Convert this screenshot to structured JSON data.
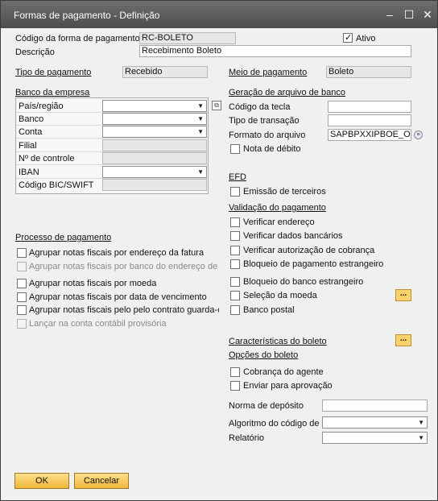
{
  "window": {
    "title": "Formas de pagamento - Definição",
    "minimize_glyph": "–",
    "maximize_glyph": "☐",
    "close_glyph": "✕"
  },
  "header": {
    "codigo_label": "Código da forma de pagamento",
    "codigo_value": "RC-BOLETO",
    "ativo_label": "Ativo",
    "ativo_checked": true,
    "descricao_label": "Descrição",
    "descricao_value": "Recebimento Boleto"
  },
  "tipo_pagamento": {
    "label": "Tipo de pagamento",
    "value": "Recebido"
  },
  "meio_pagamento": {
    "label": "Meio de pagamento",
    "value": "Boleto"
  },
  "banco_empresa": {
    "section_label": "Banco da empresa",
    "rows": [
      {
        "label": "País/região",
        "kind": "combo",
        "value": ""
      },
      {
        "label": "Banco",
        "kind": "combo",
        "value": ""
      },
      {
        "label": "Conta",
        "kind": "combo",
        "value": ""
      },
      {
        "label": "Filial",
        "kind": "readonly",
        "value": ""
      },
      {
        "label": "Nº de controle",
        "kind": "readonly",
        "value": ""
      },
      {
        "label": "IBAN",
        "kind": "combo",
        "value": ""
      },
      {
        "label": "Código BIC/SWIFT",
        "kind": "readonly",
        "value": ""
      }
    ],
    "link_icon": "link-icon"
  },
  "geracao": {
    "section_label": "Geração de arquivo de banco",
    "codigo_tecla_label": "Código da tecla",
    "codigo_tecla_value": "",
    "tipo_transacao_label": "Tipo de transação",
    "tipo_transacao_value": "",
    "formato_label": "Formato do arquivo",
    "formato_value": "SAPBPXXIPBOE_OBC",
    "nota_debito_label": "Nota de débito",
    "formato_icon": "list-icon"
  },
  "efd": {
    "section_label": "EFD",
    "emissao_label": "Emissão de terceiros"
  },
  "validacao": {
    "section_label": "Validação do pagamento",
    "items": [
      "Verificar endereço",
      "Verificar dados bancários",
      "Verificar autorização de cobrança",
      "Bloqueio de pagamento estrangeiro",
      "Bloqueio do banco estrangeiro",
      "Seleção da moeda",
      "Banco postal"
    ],
    "ellipsis": "..."
  },
  "processo": {
    "section_label": "Processo de pagamento",
    "items": [
      {
        "label": "Agrupar notas fiscais por endereço da fatura",
        "disabled": false
      },
      {
        "label": "Agrupar notas fiscais por banco do endereço de p",
        "disabled": true
      },
      {
        "label": "Agrupar notas fiscais por moeda",
        "disabled": false
      },
      {
        "label": "Agrupar notas fiscais por data de vencimento",
        "disabled": false
      },
      {
        "label": "Agrupar notas fiscais pelo pelo contrato guarda-c",
        "disabled": false
      },
      {
        "label": "Lançar na conta contábil provisória",
        "disabled": true
      }
    ]
  },
  "boleto": {
    "caracteristicas_label": "Características do boleto",
    "opcoes_label": "Opções do boleto",
    "cobranca_label": "Cobrança do agente",
    "enviar_label": "Enviar para aprovação",
    "norma_label": "Norma de depósito",
    "norma_value": "",
    "algoritmo_label": "Algoritmo do código de b",
    "algoritmo_value": "",
    "relatorio_label": "Relatório",
    "relatorio_value": "",
    "ellipsis": "..."
  },
  "footer": {
    "ok_label": "OK",
    "cancel_label": "Cancelar"
  },
  "colors": {
    "titlebar": "#5a5a5a",
    "button": "#f5c14a",
    "background": "#f0f0f0"
  }
}
